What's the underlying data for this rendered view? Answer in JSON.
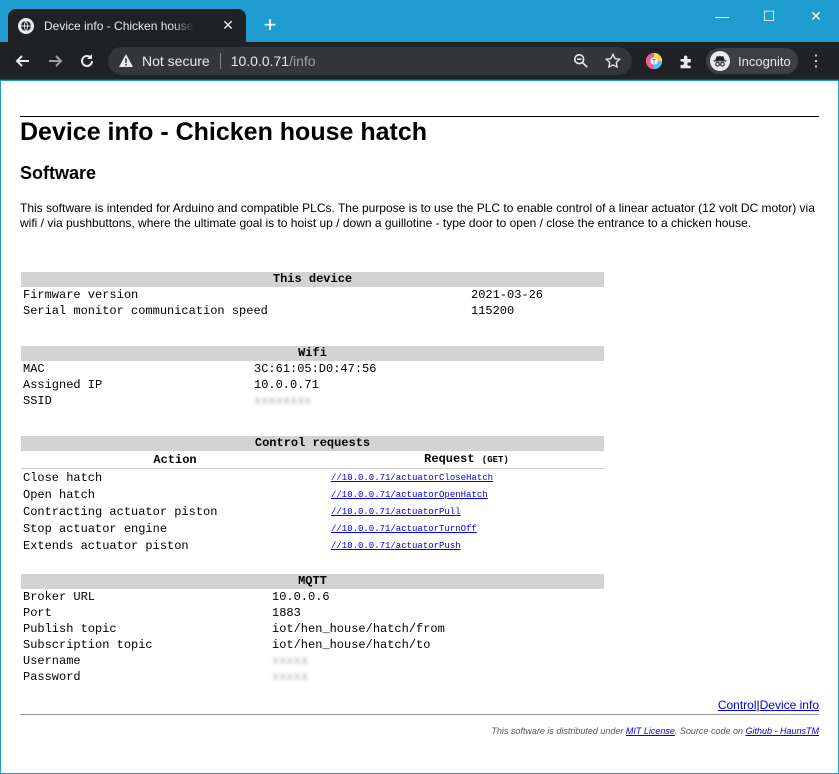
{
  "browser": {
    "tab_title": "Device info - Chicken house hatch",
    "tab_close": "✕",
    "new_tab": "+",
    "window_minimize": "—",
    "window_maximize": "☐",
    "window_close": "✕",
    "security_text": "Not secure",
    "url_host": "10.0.0.71",
    "url_path": "/info",
    "profile_label": "Incognito",
    "menu_glyph": "⋮",
    "icons": [
      "globe-icon",
      "back-icon",
      "forward-icon",
      "reload-icon",
      "warning-icon",
      "zoom-icon",
      "star-icon",
      "extension-color-icon",
      "puzzle-icon",
      "incognito-icon"
    ]
  },
  "page": {
    "title": "Device info - Chicken house hatch",
    "subtitle": "Software",
    "intro": "This software is intended for Arduino and compatible PLCs. The purpose is to use the PLC to enable control of a linear actuator (12 volt DC motor) via wifi / via pushbuttons, where the ultimate goal is to hoist up / down a guillotine - type door to open / close the entrance to a chicken house."
  },
  "this_device": {
    "heading": "This device",
    "rows": [
      {
        "label": "Firmware version",
        "value": "2021-03-26"
      },
      {
        "label": "Serial monitor communication speed",
        "value": "115200"
      }
    ]
  },
  "wifi": {
    "heading": "Wifi",
    "rows": [
      {
        "label": "MAC",
        "value": "3C:61:05:D0:47:56"
      },
      {
        "label": "Assigned IP",
        "value": "10.0.0.71"
      },
      {
        "label": "SSID",
        "value": "xxxxxxxx"
      }
    ]
  },
  "control": {
    "heading": "Control requests",
    "col_action": "Action",
    "col_request": "Request",
    "col_method": "(GET)",
    "rows": [
      {
        "action": "Close hatch",
        "request": "//10.0.0.71/actuatorCloseHatch"
      },
      {
        "action": "Open hatch",
        "request": "//10.0.0.71/actuatorOpenHatch"
      },
      {
        "action": "Contracting actuator piston",
        "request": "//10.0.0.71/actuatorPull"
      },
      {
        "action": "Stop actuator engine",
        "request": "//10.0.0.71/actuatorTurnOff"
      },
      {
        "action": "Extends actuator piston",
        "request": "//10.0.0.71/actuatorPush"
      }
    ]
  },
  "mqtt": {
    "heading": "MQTT",
    "rows": [
      {
        "label": "Broker URL",
        "value": "10.0.0.6"
      },
      {
        "label": "Port",
        "value": "1883"
      },
      {
        "label": "Publish topic",
        "value": "iot/hen_house/hatch/from"
      },
      {
        "label": "Subscription topic",
        "value": "iot/hen_house/hatch/to"
      },
      {
        "label": "Username",
        "value": "xxxxx"
      },
      {
        "label": "Password",
        "value": "xxxxx"
      }
    ]
  },
  "footer": {
    "link_control": "Control",
    "link_separator": "|",
    "link_device_info": "Device info",
    "license_prefix": "This software is distributed under ",
    "license_link": "MIT License",
    "source_prefix": ". Source code on ",
    "source_link": "Github - HaunsTM"
  }
}
